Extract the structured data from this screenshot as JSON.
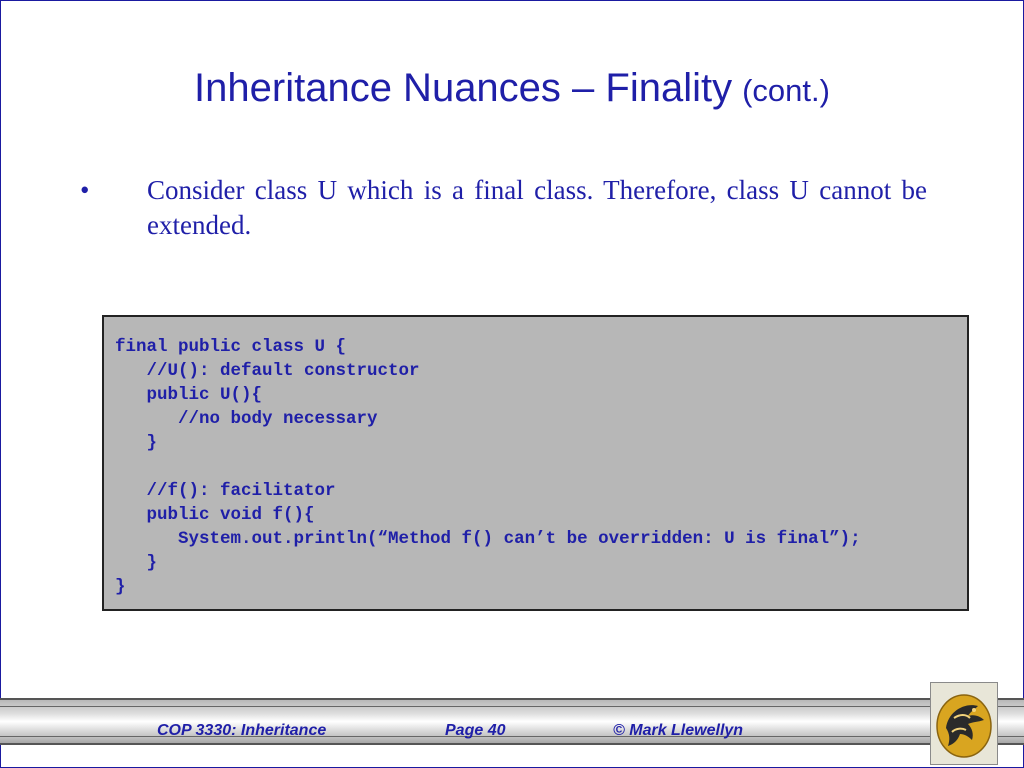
{
  "slide": {
    "title_main": "Inheritance Nuances – Finality",
    "title_sub": "(cont.)",
    "bullet_symbol": "•",
    "bullet_text": "Consider class U which is a final class.  Therefore, class U cannot be extended."
  },
  "code": {
    "lines": [
      "final public class U {",
      "   //U(): default constructor",
      "   public U(){",
      "      //no body necessary",
      "   }",
      "",
      "   //f(): facilitator",
      "   public void f(){",
      "      System.out.println(“Method f() can’t be overridden: U is final”);",
      "   }",
      "}"
    ]
  },
  "footer": {
    "course": "COP 3330:  Inheritance",
    "page": "Page 40",
    "author": "© Mark Llewellyn",
    "logo_icon": "ucf-pegasus-logo-icon"
  },
  "colors": {
    "text_blue": "#1f1fa8",
    "code_background": "#b7b7b7",
    "logo_gold": "#d9a520"
  }
}
